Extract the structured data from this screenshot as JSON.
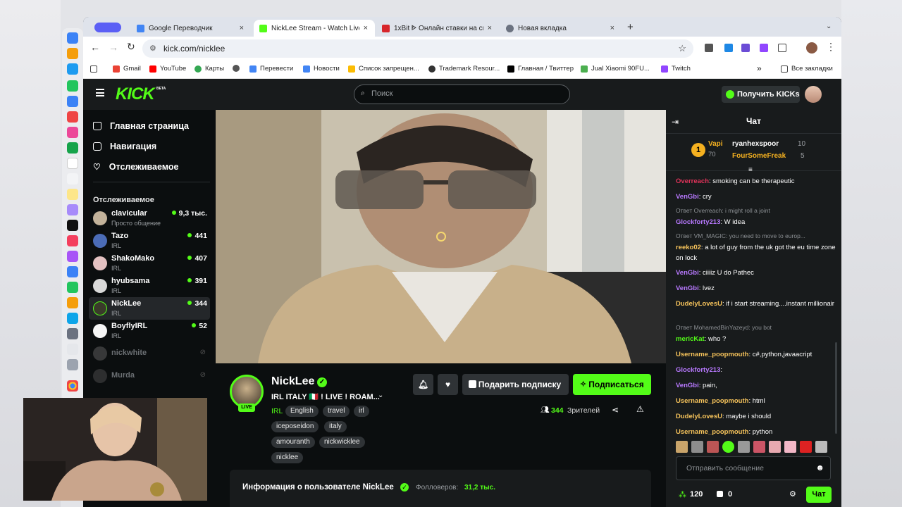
{
  "browser": {
    "tabs": [
      {
        "label": "Google Переводчик",
        "close": "×"
      },
      {
        "label": "NickLee Stream - Watch Live",
        "close": "×"
      },
      {
        "label": "1xBit ᐈ Онлайн ставки на сп",
        "close": "×"
      },
      {
        "label": "Новая вкладка",
        "close": "×"
      }
    ],
    "new_tab": "+",
    "url": "kick.com/nicklee",
    "bookmarks": [
      "Gmail",
      "YouTube",
      "Карты",
      "Перевести",
      "Новости",
      "Список запрещен...",
      "Trademark Resour...",
      "Главная / Твиттер",
      "Jual Xiaomi 90FU...",
      "Twitch"
    ],
    "all_bookmarks": "Все закладки",
    "overflow": "»"
  },
  "kick": {
    "logo": "KICK",
    "logo_badge": "BETA",
    "search_placeholder": "Поиск",
    "get_kicks": "Получить KICKs",
    "nav": [
      {
        "label": "Главная страница",
        "icon": "home-icon"
      },
      {
        "label": "Навигация",
        "icon": "browse-icon"
      },
      {
        "label": "Отслеживаемое",
        "icon": "heart-icon"
      }
    ],
    "following_heading": "Отслеживаемое",
    "channels": [
      {
        "name": "clavicular",
        "category": "Просто общение",
        "viewers": "9,3 тыс."
      },
      {
        "name": "Tazo",
        "category": "IRL",
        "viewers": "441"
      },
      {
        "name": "ShakoMako",
        "category": "IRL",
        "viewers": "407"
      },
      {
        "name": "hyubsama",
        "category": "IRL",
        "viewers": "391"
      },
      {
        "name": "NickLee",
        "category": "IRL",
        "viewers": "344"
      },
      {
        "name": "BoyflyIRL",
        "category": "IRL",
        "viewers": "52"
      },
      {
        "name": "nickwhite",
        "category": "",
        "viewers": ""
      },
      {
        "name": "Murda",
        "category": "",
        "viewers": ""
      }
    ],
    "stream": {
      "live_badge": "LIVE",
      "streamer": "NickLee",
      "title": "IRL ITALY 🇮🇹 ! LIVE ! ROAM...",
      "category": "IRL",
      "tags": [
        "English",
        "travel",
        "irl",
        "iceposeidon",
        "italy",
        "amouranth",
        "nickwicklee",
        "nicklee"
      ],
      "viewers": "344",
      "viewers_label": "Зрителей",
      "gift_sub": "Подарить подписку",
      "subscribe": "Подписаться",
      "about_title": "Информация о пользователе NickLee",
      "followers_label": "Фолловеров:",
      "followers": "31,2 тыс."
    },
    "chat": {
      "title": "Чат",
      "leaderboard": [
        {
          "rank": "1",
          "name": "Vapi",
          "amount": "70"
        },
        {
          "name": "ryanhexspoor",
          "amount": "10"
        },
        {
          "name": "FourSomeFreak",
          "amount": "5"
        }
      ],
      "messages": [
        {
          "user": "Overreach",
          "text": "smoking can be therapeutic",
          "color": "#e0335a"
        },
        {
          "user": "VenGbi",
          "text": "cry",
          "color": "#b879ff"
        },
        {
          "reply": "Ответ Overreach: i might roll a joint",
          "user": "Glockforty213",
          "text": "W idea",
          "color": "#b879ff"
        },
        {
          "reply": "Ответ VM_MAGIC: you need to move to europ...",
          "user": "reeko02",
          "text": "a lot of guy from the uk got the eu time zone on lock",
          "color": "#f6c35b"
        },
        {
          "user": "VenGbi",
          "text": "ciiiiz U do Pathec",
          "color": "#b879ff"
        },
        {
          "user": "VenGbi",
          "text": "lvez",
          "color": "#b879ff"
        },
        {
          "user": "DudelyLovesU",
          "text": "if i start streaming....instant millionair",
          "color": "#f6c35b"
        },
        {
          "reply": "Ответ MohamedBinYazeyd: you bot",
          "user": "mericKat",
          "text": "who ?",
          "color": "#53fc18"
        },
        {
          "user": "Username_poopmouth",
          "text": "c#,python,javaacript",
          "color": "#f6c35b"
        },
        {
          "user": "Glockforty213",
          "text": "",
          "color": "#b879ff"
        },
        {
          "user": "VenGbi",
          "text": "pain,",
          "color": "#b879ff"
        },
        {
          "user": "Username_poopmouth",
          "text": "html",
          "color": "#f6c35b"
        },
        {
          "user": "DudelyLovesU",
          "text": "maybe i should",
          "color": "#f6c35b"
        },
        {
          "user": "Username_poopmouth",
          "text": "python",
          "color": "#f6c35b"
        }
      ],
      "input_placeholder": "Отправить сообщение",
      "points": "120",
      "bits": "0",
      "send": "Чат"
    }
  },
  "colors": {
    "accent": "#53fc18",
    "bg": "#0b0e0f",
    "panel": "#181b1c"
  }
}
